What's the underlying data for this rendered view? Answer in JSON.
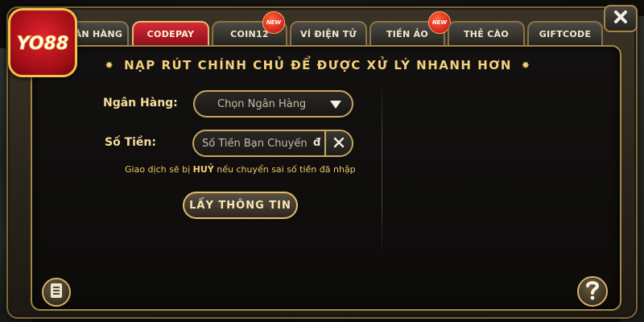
{
  "logo": {
    "text": "YO88"
  },
  "tabs": [
    {
      "label": "Ngân Hàng",
      "active": false
    },
    {
      "label": "CODEPAY",
      "active": true
    },
    {
      "label": "COIN12",
      "active": false,
      "badge": "NEW"
    },
    {
      "label": "Ví Điện Tử",
      "active": false
    },
    {
      "label": "Tiền Ảo",
      "active": false,
      "badge": "NEW"
    },
    {
      "label": "Thẻ Cào",
      "active": false
    },
    {
      "label": "GIFTCODE",
      "active": false
    }
  ],
  "title": "Nạp Rút Chính Chủ Để Được Xử Lý Nhanh Hơn",
  "form": {
    "bank_label": "Ngân Hàng:",
    "bank_select_placeholder": "Chọn Ngân Hàng",
    "amount_label": "Số Tiền:",
    "amount_placeholder": "Số Tiền Bạn Chuyển",
    "currency_symbol": "đ",
    "note_prefix": "Giao dịch sẽ bị ",
    "note_emphasis": "HUỶ",
    "note_suffix": " nếu chuyển sai số tiền đã nhập",
    "submit_label": "Lấy Thông Tin"
  },
  "icons": {
    "close": "close-icon",
    "menu": "document-list-icon",
    "help": "question-mark-icon",
    "dropdown": "triangle-down-icon"
  },
  "colors": {
    "gold": "#f4d27a",
    "active_tab": "#d62a38",
    "badge": "#d9261b"
  }
}
